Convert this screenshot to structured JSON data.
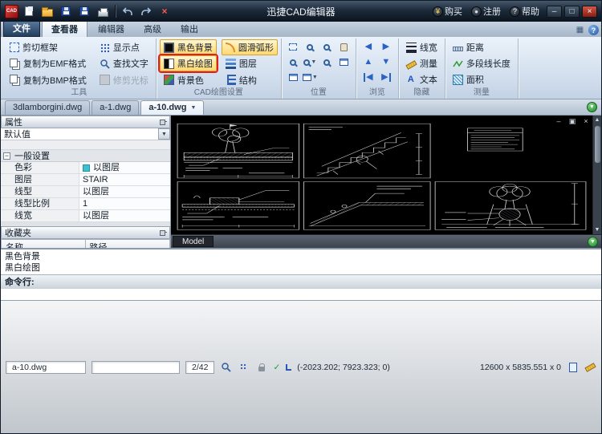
{
  "titlebar": {
    "logo_text": "CAD",
    "app_title": "迅捷CAD编辑器",
    "buy": "购买",
    "register": "注册",
    "help": "帮助"
  },
  "icons": {
    "minimize": "–",
    "maximize": "□",
    "close": "×",
    "yen": "¥",
    "question": "?",
    "dropdown": "▼",
    "up": "▲",
    "down": "▼",
    "left": "◀",
    "right": "▶",
    "collapse": "−",
    "check": "✓",
    "mdi_minimize": "–",
    "mdi_restore": "▣",
    "mdi_close": "×",
    "grid": "▦"
  },
  "menu_tabs": {
    "file": "文件",
    "viewer": "查看器",
    "editor": "编辑器",
    "advanced": "高级",
    "output": "输出"
  },
  "ribbon": {
    "groups": {
      "tools": {
        "title": "工具",
        "clip_frame": "剪切框架",
        "copy_emf": "复制为EMF格式",
        "copy_bmp": "复制为BMP格式",
        "show_points": "显示点",
        "find_text": "查找文字",
        "trim_cursor": "修剪光标"
      },
      "cad_settings": {
        "title": "CAD绘图设置",
        "black_bg": "黑色背景",
        "smooth_arc": "圆滑弧形",
        "bw_drawing": "黑白绘图",
        "layers": "图层",
        "bg_color": "背景色",
        "structure": "结构"
      },
      "position": {
        "title": "位置"
      },
      "browse": {
        "title": "浏览"
      },
      "hide": {
        "title": "隐藏",
        "line_width": "线宽",
        "measure": "测量",
        "text": "文本"
      },
      "measure": {
        "title": "测量",
        "distance": "距离",
        "polyline_length": "多段线长度",
        "area": "面积"
      }
    }
  },
  "doc_tabs": [
    "3dlamborgini.dwg",
    "a-1.dwg",
    "a-10.dwg"
  ],
  "properties_panel": {
    "title": "属性",
    "default_value": "默认值",
    "group_header": "一般设置",
    "rows": [
      {
        "label": "色彩",
        "value": "以图层"
      },
      {
        "label": "图层",
        "value": "STAIR"
      },
      {
        "label": "线型",
        "value": "以图层"
      },
      {
        "label": "线型比例",
        "value": "1"
      },
      {
        "label": "线宽",
        "value": "以图层"
      }
    ]
  },
  "favorites_panel": {
    "title": "收藏夹",
    "col_name": "名称",
    "col_path": "路径"
  },
  "canvas": {
    "model_tab": "Model"
  },
  "command_panel": {
    "history": [
      "黑色背景",
      "黑白绘图"
    ],
    "prompt_label": "命令行:"
  },
  "statusbar": {
    "file_name": "a-10.dwg",
    "page_indicator": "2/42",
    "coordinates": "(-2023.202; 7923.323; 0)",
    "dimensions": "12600 x 5835.551 x 0"
  },
  "colors": {
    "annotation_box": "#e02020",
    "canvas_background": "#000000",
    "active_tool_highlight": "#ffd870"
  }
}
